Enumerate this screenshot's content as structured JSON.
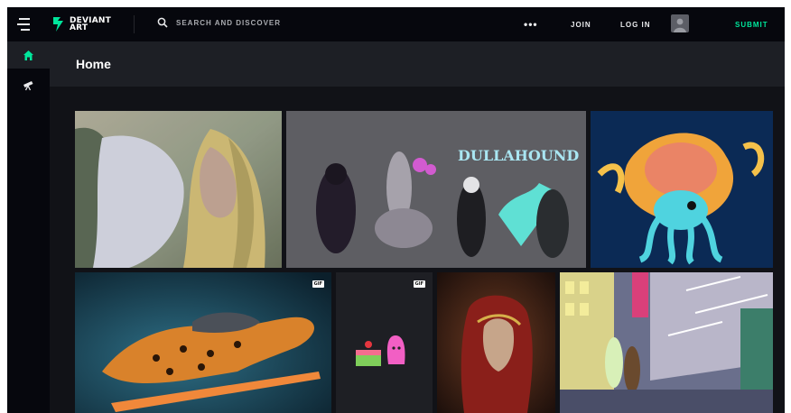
{
  "topbar": {
    "logo_text": "DEVIANT\nART",
    "search_placeholder": "SEARCH AND DISCOVER",
    "more_label": "•••",
    "join_label": "JOIN",
    "login_label": "LOG IN",
    "submit_label": "SUBMIT"
  },
  "rail": {
    "items": [
      {
        "icon": "home-icon",
        "active": true
      },
      {
        "icon": "telescope-icon",
        "active": false
      }
    ]
  },
  "main": {
    "title": "Home"
  },
  "badges": {
    "gif": "GIF"
  },
  "colors": {
    "background": "#06070d",
    "header": "#1d1f25",
    "accent": "#00e59b",
    "text": "#e9eaec"
  }
}
